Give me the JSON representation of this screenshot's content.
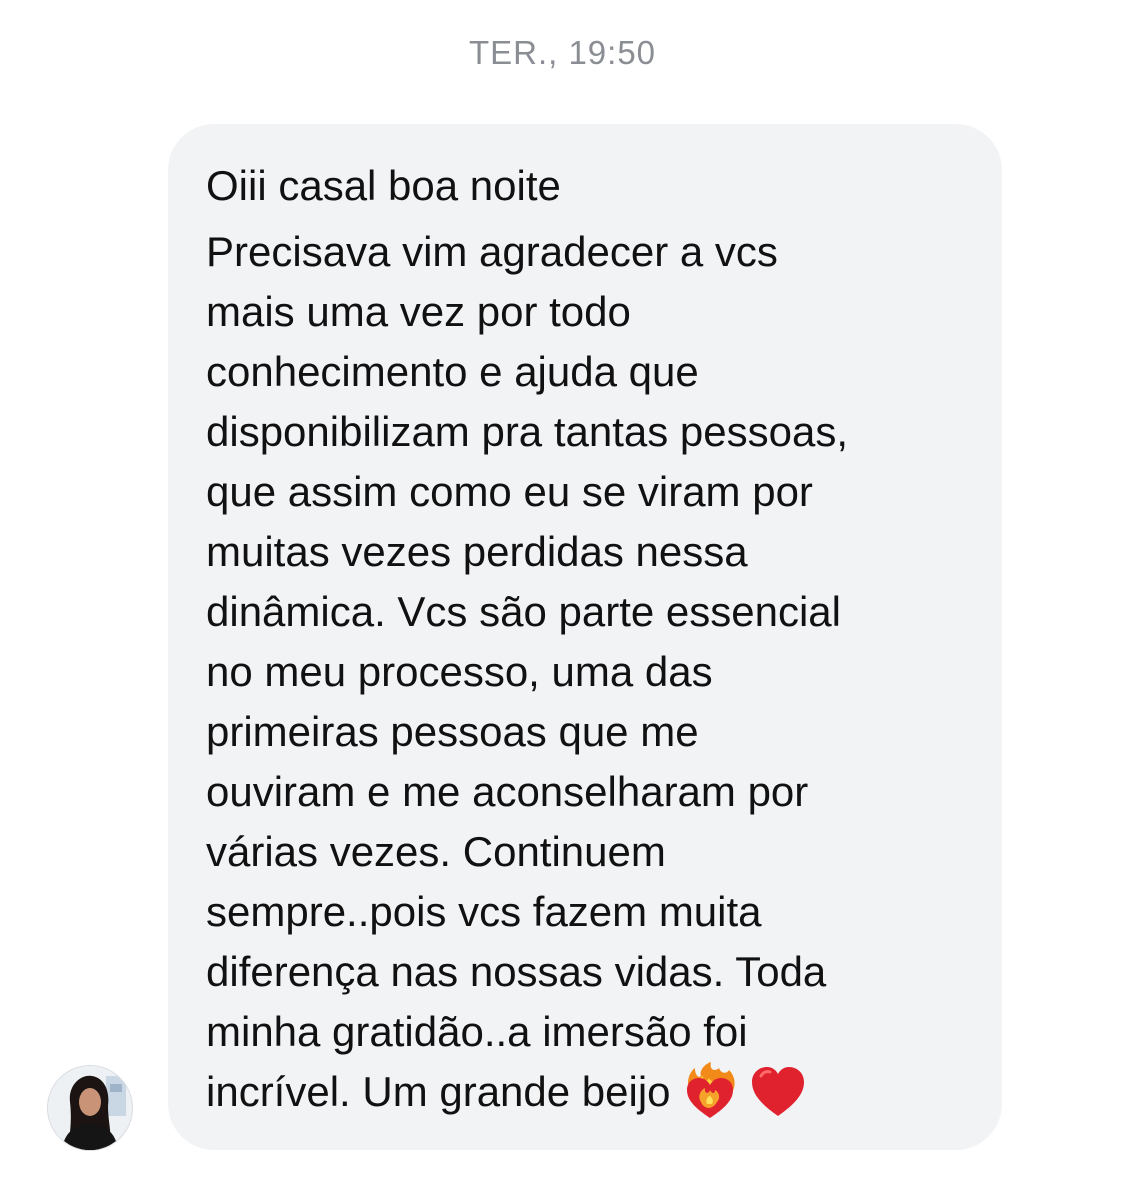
{
  "conversation": {
    "timestamp": "TER., 19:50",
    "sender": {
      "avatar_icon": "user-avatar-photo"
    },
    "message": {
      "lines": [
        "Oiii casal boa noite",
        "Precisava vim agradecer a vcs",
        "mais uma vez por todo",
        "conhecimento e ajuda que",
        "disponibilizam pra tantas pessoas,",
        "que assim como eu se viram por",
        "muitas vezes perdidas nessa",
        "dinâmica. Vcs são parte essencial",
        "no meu processo, uma das",
        "primeiras pessoas que me",
        "ouviram e me aconselharam por",
        "várias vezes. Continuem",
        "sempre..pois vcs fazem muita",
        "diferença nas nossas vidas. Toda",
        "minha gratidão..a imersão foi",
        "incrível. Um grande beijo"
      ],
      "emojis": [
        "heart-on-fire-emoji",
        "red-heart-emoji"
      ]
    }
  },
  "colors": {
    "bubble_background": "#f2f3f5",
    "timestamp_text": "#8a8d93",
    "message_text": "#111111",
    "heart_red": "#e0222f"
  }
}
